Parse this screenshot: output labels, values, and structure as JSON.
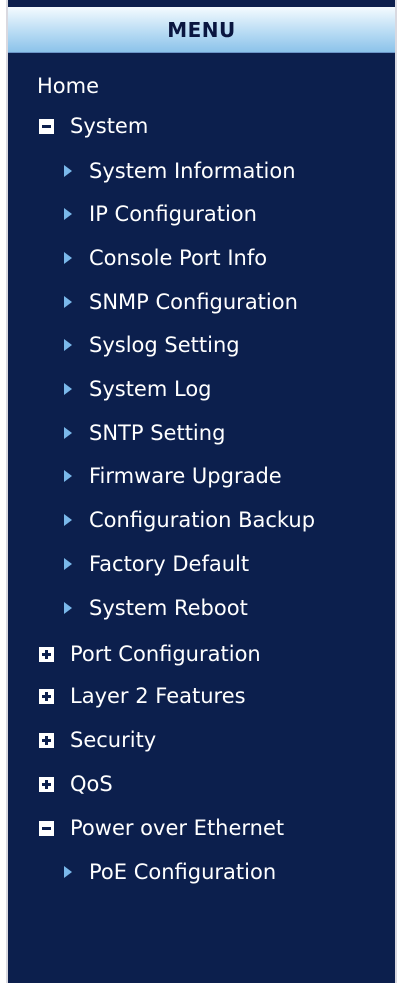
{
  "menu": {
    "title": "MENU",
    "home": "Home",
    "system": {
      "label": "System",
      "items": [
        "System Information",
        "IP Configuration",
        "Console Port Info",
        "SNMP Configuration",
        "Syslog Setting",
        "System Log",
        "SNTP Setting",
        "Firmware Upgrade",
        "Configuration Backup",
        "Factory Default",
        "System Reboot"
      ]
    },
    "collapsed_sections": [
      "Port Configuration",
      "Layer 2 Features",
      "Security",
      "QoS"
    ],
    "poe": {
      "label": "Power over Ethernet",
      "items": [
        "PoE Configuration"
      ]
    }
  },
  "colors": {
    "panel_background": "#0c1f4d",
    "header_gradient_top": "#f4fbff",
    "header_gradient_bottom": "#8cc3ea",
    "text": "#ffffff",
    "bullet": "#7ab8ea"
  },
  "icons": {
    "expanded": "minus-box-icon",
    "collapsed": "plus-box-icon",
    "leaf": "triangle-right-icon"
  }
}
